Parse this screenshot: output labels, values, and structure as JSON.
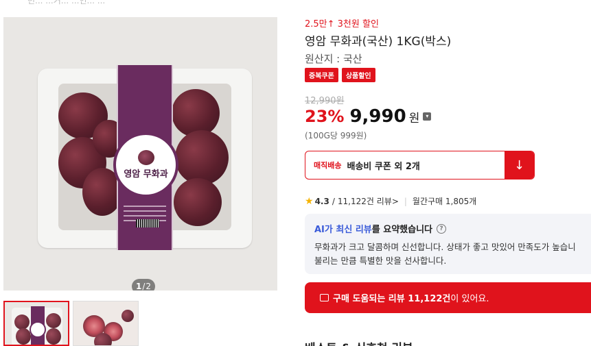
{
  "breadcrumb": "빈...  ...거...  ...인...  ...",
  "gallery": {
    "pager_current": "1",
    "pager_sep": "/",
    "pager_total": "2",
    "package_label": "영암 무화과"
  },
  "product": {
    "promo": "2.5만↑ 3천원 할인",
    "title": "영암 무화과(국산) 1KG(박스)",
    "origin": "원산지 : 국산",
    "tags": [
      "중복쿠폰",
      "상품할인"
    ],
    "original_price": "12,990원",
    "discount": "23%",
    "price": "9,990",
    "currency": "원",
    "unit_price": "(100G당 999원)"
  },
  "delivery": {
    "label": "매직배송",
    "text": "배송비 쿠폰 외 2개",
    "button_icon": "download-arrow-icon"
  },
  "rating": {
    "score": "4.3",
    "review_count": "11,122건 리뷰",
    "chevron": ">",
    "monthly": "월간구매 1,805개"
  },
  "ai_summary": {
    "title_highlight": "AI가 최신 리뷰",
    "title_rest": "를 요약했습니다",
    "help": "?",
    "line1": "무화과가 크고 달콤하며 신선합니다. 상태가 좋고 맛있어 만족도가 높습니",
    "line2": "불리는 만큼 특별한 맛을 선사합니다."
  },
  "review_bar": {
    "bold": "구매 도움되는 리뷰 11,122건",
    "rest": " 이 있어요."
  },
  "bottom_heading": "베스트 & 신호천 리뷰"
}
